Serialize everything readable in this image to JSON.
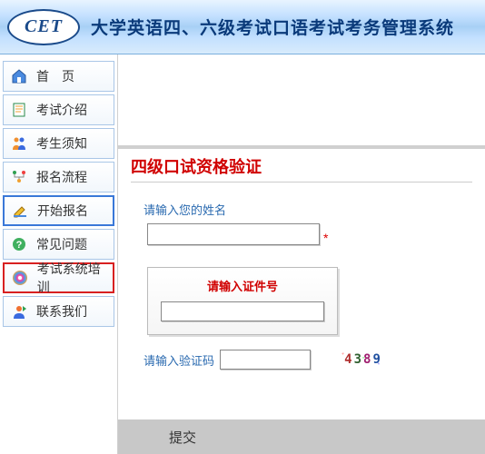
{
  "header": {
    "logo_text": "CET",
    "title": "大学英语四、六级考试口语考试考务管理系统"
  },
  "sidebar": {
    "items": [
      {
        "label": "首　页"
      },
      {
        "label": "考试介绍"
      },
      {
        "label": "考生须知"
      },
      {
        "label": "报名流程"
      },
      {
        "label": "开始报名"
      },
      {
        "label": "常见问题"
      },
      {
        "label": "考试系统培训"
      },
      {
        "label": "联系我们"
      }
    ]
  },
  "form": {
    "title": "四级口试资格验证",
    "name_label": "请输入您的姓名",
    "asterisk": "*",
    "id_label": "请输入证件号",
    "captcha_label": "请输入验证码",
    "captcha_value": "4389",
    "submit_label": "提交"
  }
}
